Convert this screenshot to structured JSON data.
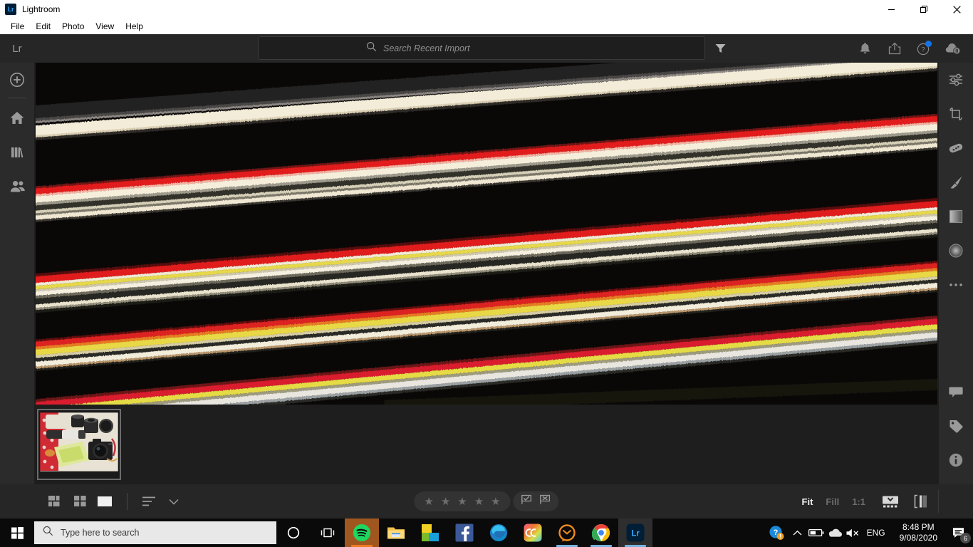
{
  "window": {
    "app_icon": "lr-icon",
    "title": "Lightroom",
    "minimize": "minimize-icon",
    "restore": "restore-icon",
    "close": "close-icon"
  },
  "menubar": {
    "items": [
      {
        "label": "File"
      },
      {
        "label": "Edit"
      },
      {
        "label": "Photo"
      },
      {
        "label": "View"
      },
      {
        "label": "Help"
      }
    ]
  },
  "lr_header": {
    "logo": "Lr",
    "search": {
      "placeholder": "Search Recent Import",
      "value": "",
      "icon": "search-icon"
    },
    "filter_icon": "filter-icon",
    "actions": [
      {
        "name": "notifications-bell-icon",
        "badge": ""
      },
      {
        "name": "share-icon",
        "badge": ""
      },
      {
        "name": "help-icon",
        "badge": "dot"
      },
      {
        "name": "cloud-sync-paused-icon",
        "badge": ""
      }
    ]
  },
  "left_rail": {
    "items": [
      {
        "name": "add-photos-icon",
        "label": "Add Photos"
      },
      {
        "name": "home-icon",
        "label": "Home"
      },
      {
        "name": "library-icon",
        "label": "Library"
      },
      {
        "name": "shared-icon",
        "label": "Shared"
      }
    ]
  },
  "right_rail": {
    "top_items": [
      {
        "name": "edit-sliders-icon",
        "label": "Edit"
      },
      {
        "name": "crop-icon",
        "label": "Crop & Rotate"
      },
      {
        "name": "healing-brush-icon",
        "label": "Healing Brush"
      },
      {
        "name": "brush-icon",
        "label": "Brush"
      },
      {
        "name": "linear-gradient-icon",
        "label": "Linear Gradient"
      },
      {
        "name": "radial-gradient-icon",
        "label": "Radial Gradient"
      },
      {
        "name": "more-options-icon",
        "label": "More"
      }
    ],
    "bottom_items": [
      {
        "name": "comments-icon",
        "label": "Comments"
      },
      {
        "name": "keywords-tag-icon",
        "label": "Keywords"
      },
      {
        "name": "info-icon",
        "label": "Info"
      }
    ]
  },
  "photo": {
    "alt": "motion-blurred abstract photo with diagonal red, yellow and cream streaks on black",
    "background": "#0a0808"
  },
  "filmstrip": {
    "thumbnails": [
      {
        "name": "photo-thumbnail",
        "alt": "camera lenses and DSLR on red and white cloth with map",
        "selected": true
      }
    ]
  },
  "bottom_toolbar": {
    "view_modes": [
      {
        "name": "grid-view-icon",
        "label": "Grid View",
        "active": false
      },
      {
        "name": "square-grid-view-icon",
        "label": "Square Grid",
        "active": false
      },
      {
        "name": "detail-view-icon",
        "label": "Detail View",
        "active": true
      }
    ],
    "sort_icon": "sort-icon",
    "sort_chevron": "chevron-down-icon",
    "rating": {
      "stars": 5,
      "filled": 0,
      "star_glyph": "★"
    },
    "flags": [
      {
        "name": "flag-pick-icon",
        "label": "Pick"
      },
      {
        "name": "flag-reject-icon",
        "label": "Reject"
      }
    ],
    "zoom_levels": [
      {
        "label": "Fit",
        "active": true
      },
      {
        "label": "Fill",
        "active": false
      },
      {
        "label": "1:1",
        "active": false
      }
    ],
    "right_icons": [
      {
        "name": "filmstrip-toggle-icon",
        "label": "Show Filmstrip"
      },
      {
        "name": "before-after-icon",
        "label": "Before / After"
      }
    ]
  },
  "taskbar": {
    "start_icon": "windows-start-icon",
    "search": {
      "placeholder": "Type here to search",
      "icon": "search-icon"
    },
    "cortana_icon": "cortana-icon",
    "taskview_icon": "task-view-icon",
    "apps": [
      {
        "name": "spotify-icon",
        "label": "Spotify",
        "running": true,
        "active": true,
        "underline": "#f07a21"
      },
      {
        "name": "file-explorer-icon",
        "label": "File Explorer",
        "running": false,
        "active": false,
        "underline": ""
      },
      {
        "name": "microsoft-store-icon",
        "label": "Microsoft Store",
        "running": false,
        "active": false,
        "underline": ""
      },
      {
        "name": "facebook-icon",
        "label": "Facebook",
        "running": false,
        "active": false,
        "underline": ""
      },
      {
        "name": "microsoft-edge-icon",
        "label": "Microsoft Edge",
        "running": false,
        "active": false,
        "underline": ""
      },
      {
        "name": "creative-cloud-icon",
        "label": "Creative Cloud",
        "running": true,
        "active": false,
        "underline": "#77b3e0"
      },
      {
        "name": "thunderbird-icon",
        "label": "Thunderbird",
        "running": true,
        "active": false,
        "underline": "#77b3e0"
      },
      {
        "name": "google-chrome-icon",
        "label": "Google Chrome",
        "running": true,
        "active": false,
        "underline": "#77b3e0"
      },
      {
        "name": "lightroom-icon",
        "label": "Lightroom",
        "running": true,
        "active": true,
        "underline": "#77b3e0"
      }
    ],
    "tray": {
      "items": [
        {
          "name": "help-warning-icon",
          "label": "Get Help"
        },
        {
          "name": "show-hidden-icons-icon",
          "label": "Show hidden icons"
        },
        {
          "name": "battery-icon",
          "label": "Battery"
        },
        {
          "name": "onedrive-icon",
          "label": "OneDrive"
        },
        {
          "name": "volume-muted-icon",
          "label": "Volume muted"
        }
      ],
      "language": "ENG",
      "time": "8:48 PM",
      "date": "9/08/2020",
      "notifications": {
        "name": "action-center-icon",
        "count": "6"
      }
    }
  }
}
